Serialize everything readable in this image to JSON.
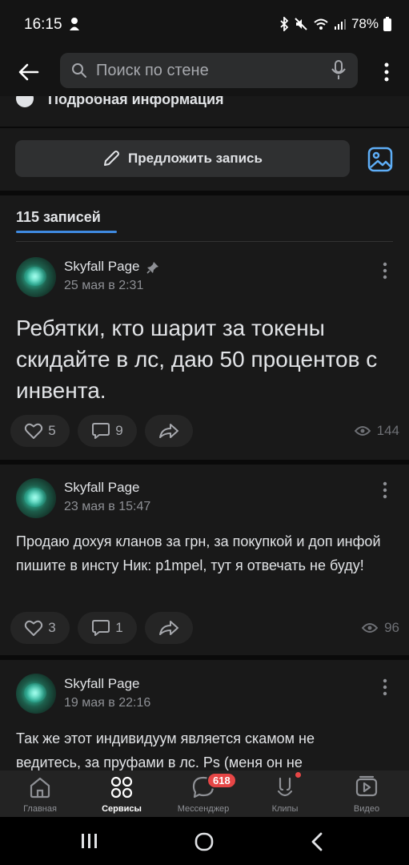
{
  "status_bar": {
    "time": "16:15",
    "battery": "78%"
  },
  "top_bar": {
    "search_placeholder": "Поиск по стене"
  },
  "info_strip": {
    "label": "Подробная информация"
  },
  "suggest": {
    "label": "Предложить запись"
  },
  "wall": {
    "posts_count": "115 записей"
  },
  "posts": [
    {
      "author": "Skyfall Page",
      "date": "25 мая в 2:31",
      "pinned": true,
      "text": "Ребятки, кто шарит за токены скидайте в лс, даю 50 процентов с инвента.",
      "likes": "5",
      "comments": "9",
      "views": "144"
    },
    {
      "author": "Skyfall Page",
      "date": "23 мая в 15:47",
      "pinned": false,
      "text": "Продаю дохуя кланов за грн, за покупкой и доп инфой пишите в инсту Ник: p1mpel, тут я отвечать не буду!",
      "likes": "3",
      "comments": "1",
      "views": "96"
    },
    {
      "author": "Skyfall Page",
      "date": "19 мая в 22:16",
      "pinned": false,
      "text": "Так же этот индивидуум является скамом не ведитесь, за пруфами в лс. Ps (меня он не"
    }
  ],
  "bottom_nav": {
    "items": [
      {
        "label": "Главная",
        "icon": "home-icon"
      },
      {
        "label": "Сервисы",
        "icon": "services-icon"
      },
      {
        "label": "Мессенджер",
        "icon": "messenger-icon"
      },
      {
        "label": "Клипы",
        "icon": "clips-icon"
      },
      {
        "label": "Видео",
        "icon": "video-icon"
      }
    ],
    "messenger_badge": "618"
  },
  "colors": {
    "accent": "#3f8ae0",
    "badge": "#e64646",
    "background": "#191919"
  }
}
